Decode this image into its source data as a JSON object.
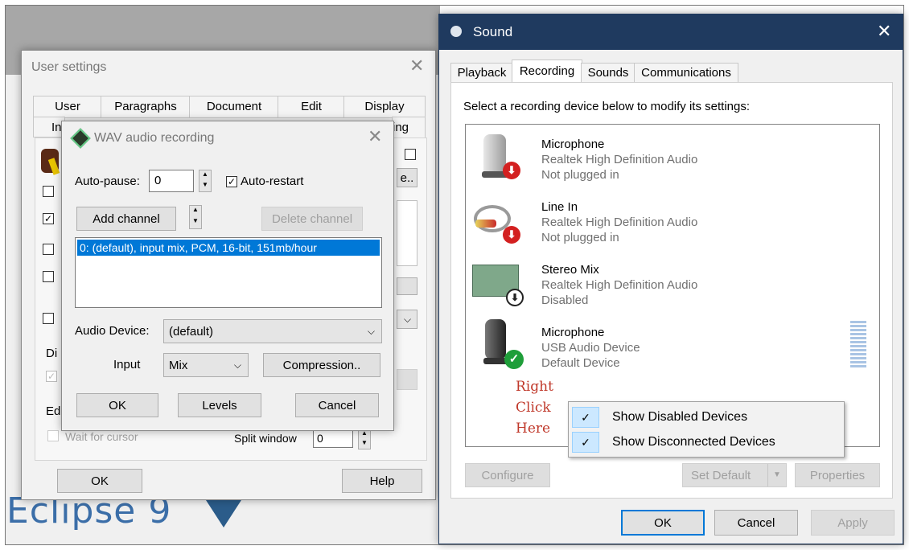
{
  "desktop": {
    "logo_text": "Eclipse 9"
  },
  "user_settings": {
    "title": "User settings",
    "tabs_row1": [
      "User",
      "Paragraphs",
      "Document",
      "Edit",
      "Display"
    ],
    "tabs_row2_partial": [
      "In",
      "ing"
    ],
    "left_partial": [
      "Di",
      "Ed"
    ],
    "wait_for_cursor": "Wait for cursor",
    "split_window_label": "Split window",
    "split_window_value": "0",
    "ok": "OK",
    "help": "Help"
  },
  "wav": {
    "title": "WAV audio recording",
    "auto_pause_label": "Auto-pause:",
    "auto_pause_value": "0",
    "auto_restart_label": "Auto-restart",
    "add_channel": "Add channel",
    "delete_channel": "Delete channel",
    "channel_item": "0: (default), input mix, PCM, 16-bit, 151mb/hour",
    "audio_device_label": "Audio Device:",
    "audio_device_value": "(default)",
    "input_label": "Input",
    "input_value": "Mix",
    "compression": "Compression..",
    "ok": "OK",
    "levels": "Levels",
    "cancel": "Cancel"
  },
  "sound": {
    "title": "Sound",
    "tabs": [
      "Playback",
      "Recording",
      "Sounds",
      "Communications"
    ],
    "instruction": "Select a recording device below to modify its settings:",
    "devices": [
      {
        "name": "Microphone",
        "driver": "Realtek High Definition Audio",
        "status": "Not plugged in"
      },
      {
        "name": "Line In",
        "driver": "Realtek High Definition Audio",
        "status": "Not plugged in"
      },
      {
        "name": "Stereo Mix",
        "driver": "Realtek High Definition Audio",
        "status": "Disabled"
      },
      {
        "name": "Microphone",
        "driver": "USB Audio Device",
        "status": "Default Device"
      }
    ],
    "annotation": [
      "Right",
      "Click",
      "Here"
    ],
    "context_menu": [
      "Show Disabled Devices",
      "Show Disconnected Devices"
    ],
    "configure": "Configure",
    "set_default": "Set Default",
    "properties": "Properties",
    "ok": "OK",
    "cancel": "Cancel",
    "apply": "Apply"
  },
  "colors": {
    "selection": "#0078d7",
    "annotation": "#c0392b",
    "menu_check_bg": "#cce8ff"
  }
}
